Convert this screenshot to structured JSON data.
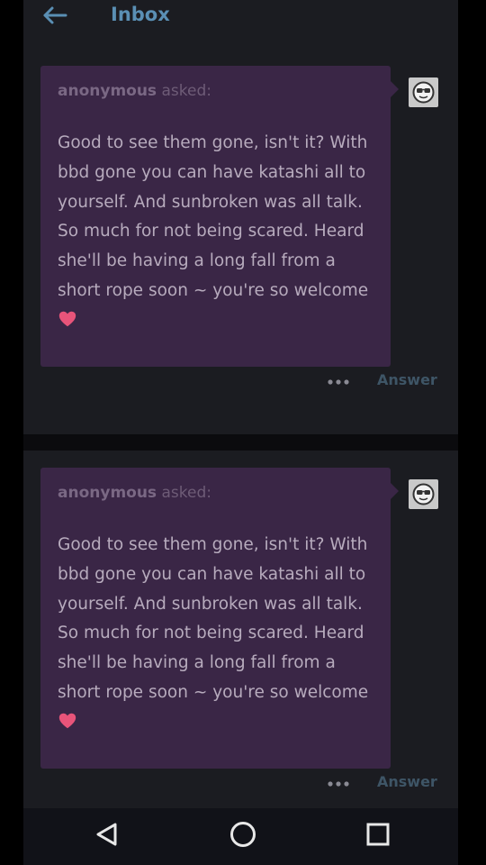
{
  "header": {
    "title": "Inbox"
  },
  "messages": [
    {
      "asker_name": "anonymous",
      "asker_suffix": "asked:",
      "body": "Good to see them gone, isn't it? With bbd gone you can have katashi all to yourself. And sunbroken was all talk. So much for not being scared. Heard she'll be having a long fall from a short rope soon ~ you're so welcome",
      "answer_label": "Answer"
    },
    {
      "asker_name": "anonymous",
      "asker_suffix": "asked:",
      "body": "Good to see them gone, isn't it? With bbd gone you can have katashi all to yourself. And sunbroken was all talk. So much for not being scared. Heard she'll be having a long fall from a short rope soon ~ you're so welcome",
      "answer_label": "Answer"
    }
  ],
  "icons": {
    "back": "arrow-left-icon",
    "avatar": "anonymous-sunglasses-avatar",
    "more": "more-horizontal-icon",
    "heart": "heart-emoji",
    "nav_back": "triangle-back-icon",
    "nav_home": "circle-home-icon",
    "nav_recents": "square-recents-icon"
  },
  "colors": {
    "background": "#111218",
    "card": "#1b1c21",
    "bubble": "#3a2646",
    "accent": "#5a8fb4",
    "message_text": "#b7abbd",
    "heart": "#e8547a"
  }
}
